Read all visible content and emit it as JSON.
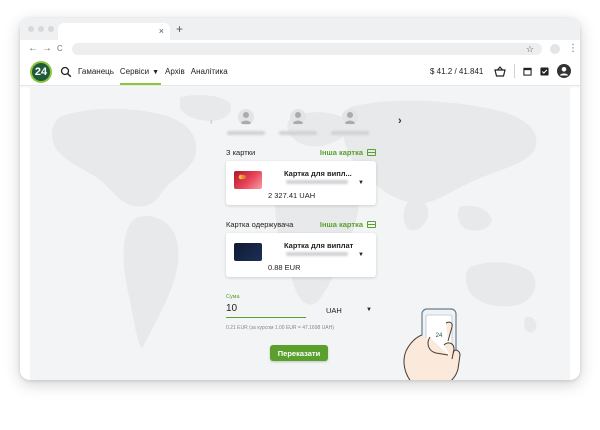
{
  "browser": {
    "tab_close": "×",
    "new_tab": "+",
    "back": "←",
    "forward": "→",
    "reload": "C",
    "bookmark": "☆",
    "menu": "⋮"
  },
  "app": {
    "logo_text": "24",
    "nav": {
      "wallet": "Гаманець",
      "services": "Сервіси",
      "archive": "Архів",
      "analytics": "Аналітика"
    },
    "rate": "$ 41.2 / 41.841"
  },
  "transfer": {
    "arrow_prev": "‹",
    "arrow_next": "›",
    "from_label": "З картки",
    "to_label": "Картка одержувача",
    "other_card": "Інша картка",
    "from_card": {
      "name": "Картка для випл...",
      "balance": "2 327.41 UAH"
    },
    "to_card": {
      "name": "Картка для виплат",
      "balance": "0.88 EUR"
    },
    "amount_label": "Сума",
    "amount_value": "10",
    "currency": "UAH",
    "rate_note": "0.21 EUR (за курсом 1.00 EUR = 47.1698 UAH)",
    "submit": "Переказати"
  },
  "phone": {
    "screen_text": "24"
  },
  "colors": {
    "accent": "#5aa02c",
    "logo_bg": "#1f5a3a",
    "logo_ring": "#8fc43e"
  }
}
